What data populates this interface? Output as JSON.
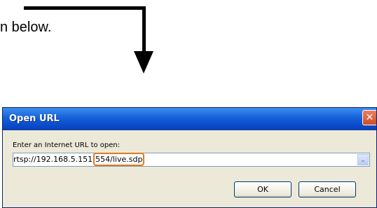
{
  "instruction": {
    "text": "n below."
  },
  "dialog": {
    "title": "Open URL",
    "close_glyph": "✕",
    "prompt": "Enter an Internet URL to open:",
    "url_prefix": "rtsp://192.168.5.151",
    "url_highlight": "554/live.sdp",
    "dropdown_glyph": "⌄",
    "ok_label": "OK",
    "cancel_label": "Cancel"
  },
  "colors": {
    "highlight": "#e07b20",
    "titlebar": "#1560d8"
  }
}
